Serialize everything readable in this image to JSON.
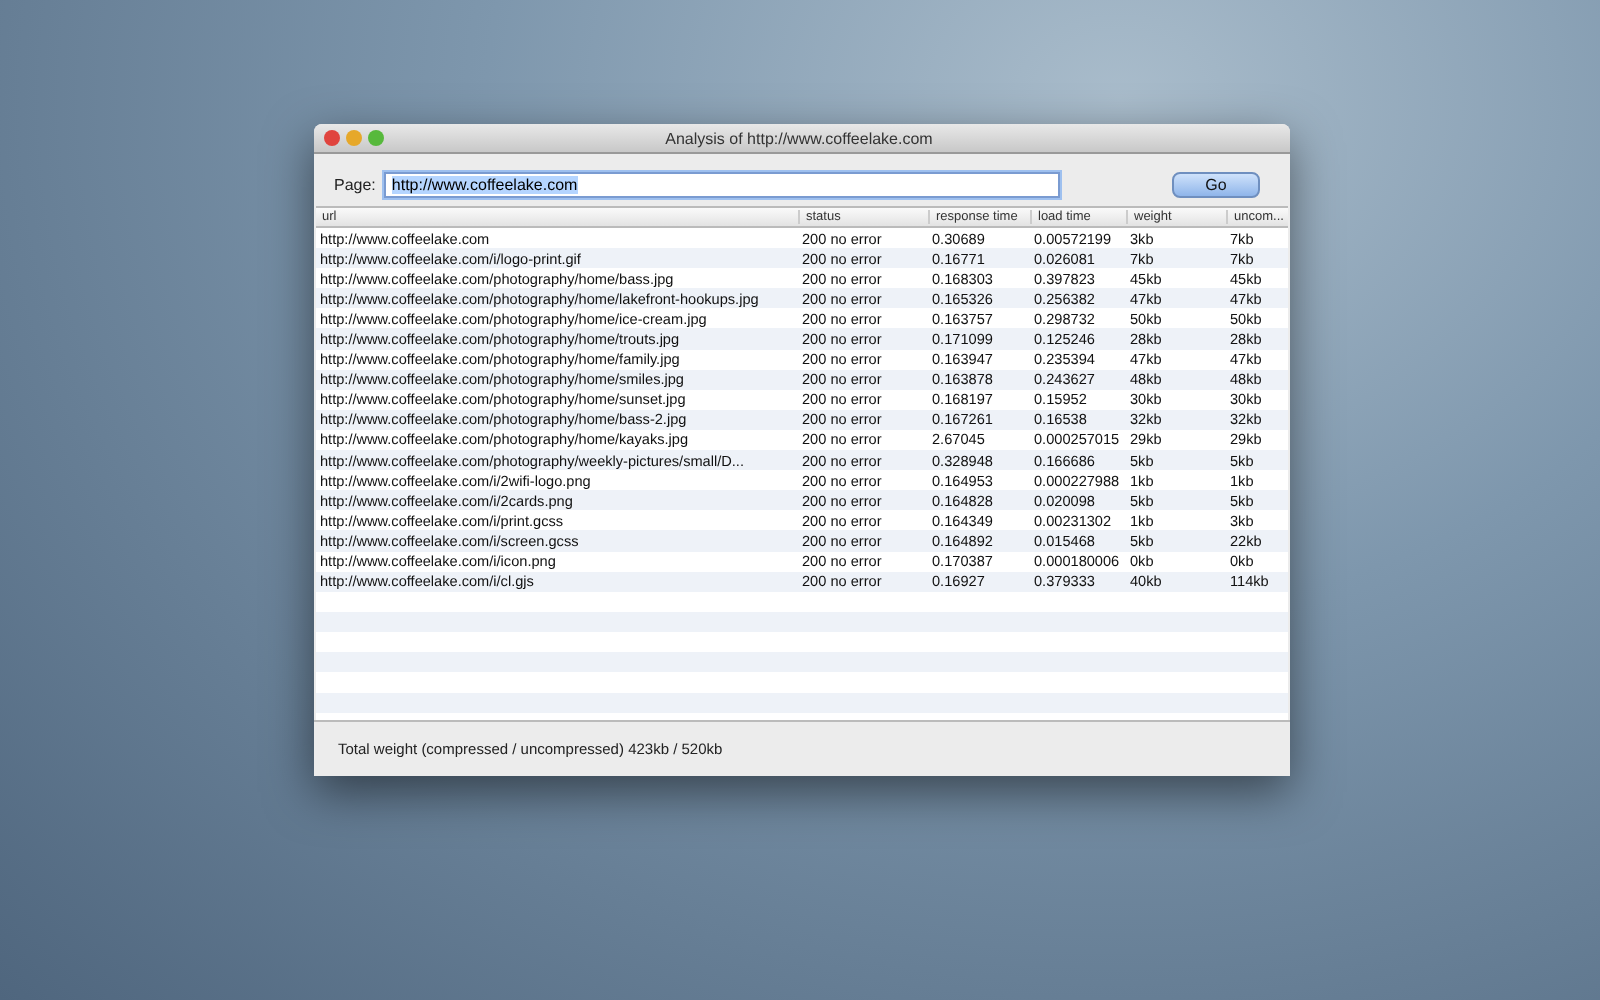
{
  "window": {
    "title": "Analysis of http://www.coffeelake.com"
  },
  "page_field": {
    "label": "Page:",
    "value": "http://www.coffeelake.com"
  },
  "go_button": "Go",
  "table": {
    "columns": [
      "url",
      "status",
      "response time",
      "load time",
      "weight",
      "uncom..."
    ],
    "rows": [
      [
        "http://www.coffeelake.com",
        "200 no error",
        "0.30689",
        "0.00572199",
        "3kb",
        "7kb"
      ],
      [
        "http://www.coffeelake.com/i/logo-print.gif",
        "200 no error",
        "0.16771",
        "0.026081",
        "7kb",
        "7kb"
      ],
      [
        "http://www.coffeelake.com/photography/home/bass.jpg",
        "200 no error",
        "0.168303",
        "0.397823",
        "45kb",
        "45kb"
      ],
      [
        "http://www.coffeelake.com/photography/home/lakefront-hookups.jpg",
        "200 no error",
        "0.165326",
        "0.256382",
        "47kb",
        "47kb"
      ],
      [
        "http://www.coffeelake.com/photography/home/ice-cream.jpg",
        "200 no error",
        "0.163757",
        "0.298732",
        "50kb",
        "50kb"
      ],
      [
        "http://www.coffeelake.com/photography/home/trouts.jpg",
        "200 no error",
        "0.171099",
        "0.125246",
        "28kb",
        "28kb"
      ],
      [
        "http://www.coffeelake.com/photography/home/family.jpg",
        "200 no error",
        "0.163947",
        "0.235394",
        "47kb",
        "47kb"
      ],
      [
        "http://www.coffeelake.com/photography/home/smiles.jpg",
        "200 no error",
        "0.163878",
        "0.243627",
        "48kb",
        "48kb"
      ],
      [
        "http://www.coffeelake.com/photography/home/sunset.jpg",
        "200 no error",
        "0.168197",
        "0.15952",
        "30kb",
        "30kb"
      ],
      [
        "http://www.coffeelake.com/photography/home/bass-2.jpg",
        "200 no error",
        "0.167261",
        "0.16538",
        "32kb",
        "32kb"
      ],
      [
        "http://www.coffeelake.com/photography/home/kayaks.jpg",
        "200 no error",
        "2.67045",
        "0.000257015",
        "29kb",
        "29kb"
      ],
      [
        "http://www.coffeelake.com/photography/weekly-pictures/small/D...",
        "200 no error",
        "0.328948",
        "0.166686",
        "5kb",
        "5kb"
      ],
      [
        "http://www.coffeelake.com/i/2wifi-logo.png",
        "200 no error",
        "0.164953",
        "0.000227988",
        "1kb",
        "1kb"
      ],
      [
        "http://www.coffeelake.com/i/2cards.png",
        "200 no error",
        "0.164828",
        "0.020098",
        "5kb",
        "5kb"
      ],
      [
        "http://www.coffeelake.com/i/print.gcss",
        "200 no error",
        "0.164349",
        "0.00231302",
        "1kb",
        "3kb"
      ],
      [
        "http://www.coffeelake.com/i/screen.gcss",
        "200 no error",
        "0.164892",
        "0.015468",
        "5kb",
        "22kb"
      ],
      [
        "http://www.coffeelake.com/i/icon.png",
        "200 no error",
        "0.170387",
        "0.000180006",
        "0kb",
        "0kb"
      ],
      [
        "http://www.coffeelake.com/i/cl.gjs",
        "200 no error",
        "0.16927",
        "0.379333",
        "40kb",
        "114kb"
      ]
    ]
  },
  "status_bar": "Total weight (compressed / uncompressed) 423kb / 520kb"
}
